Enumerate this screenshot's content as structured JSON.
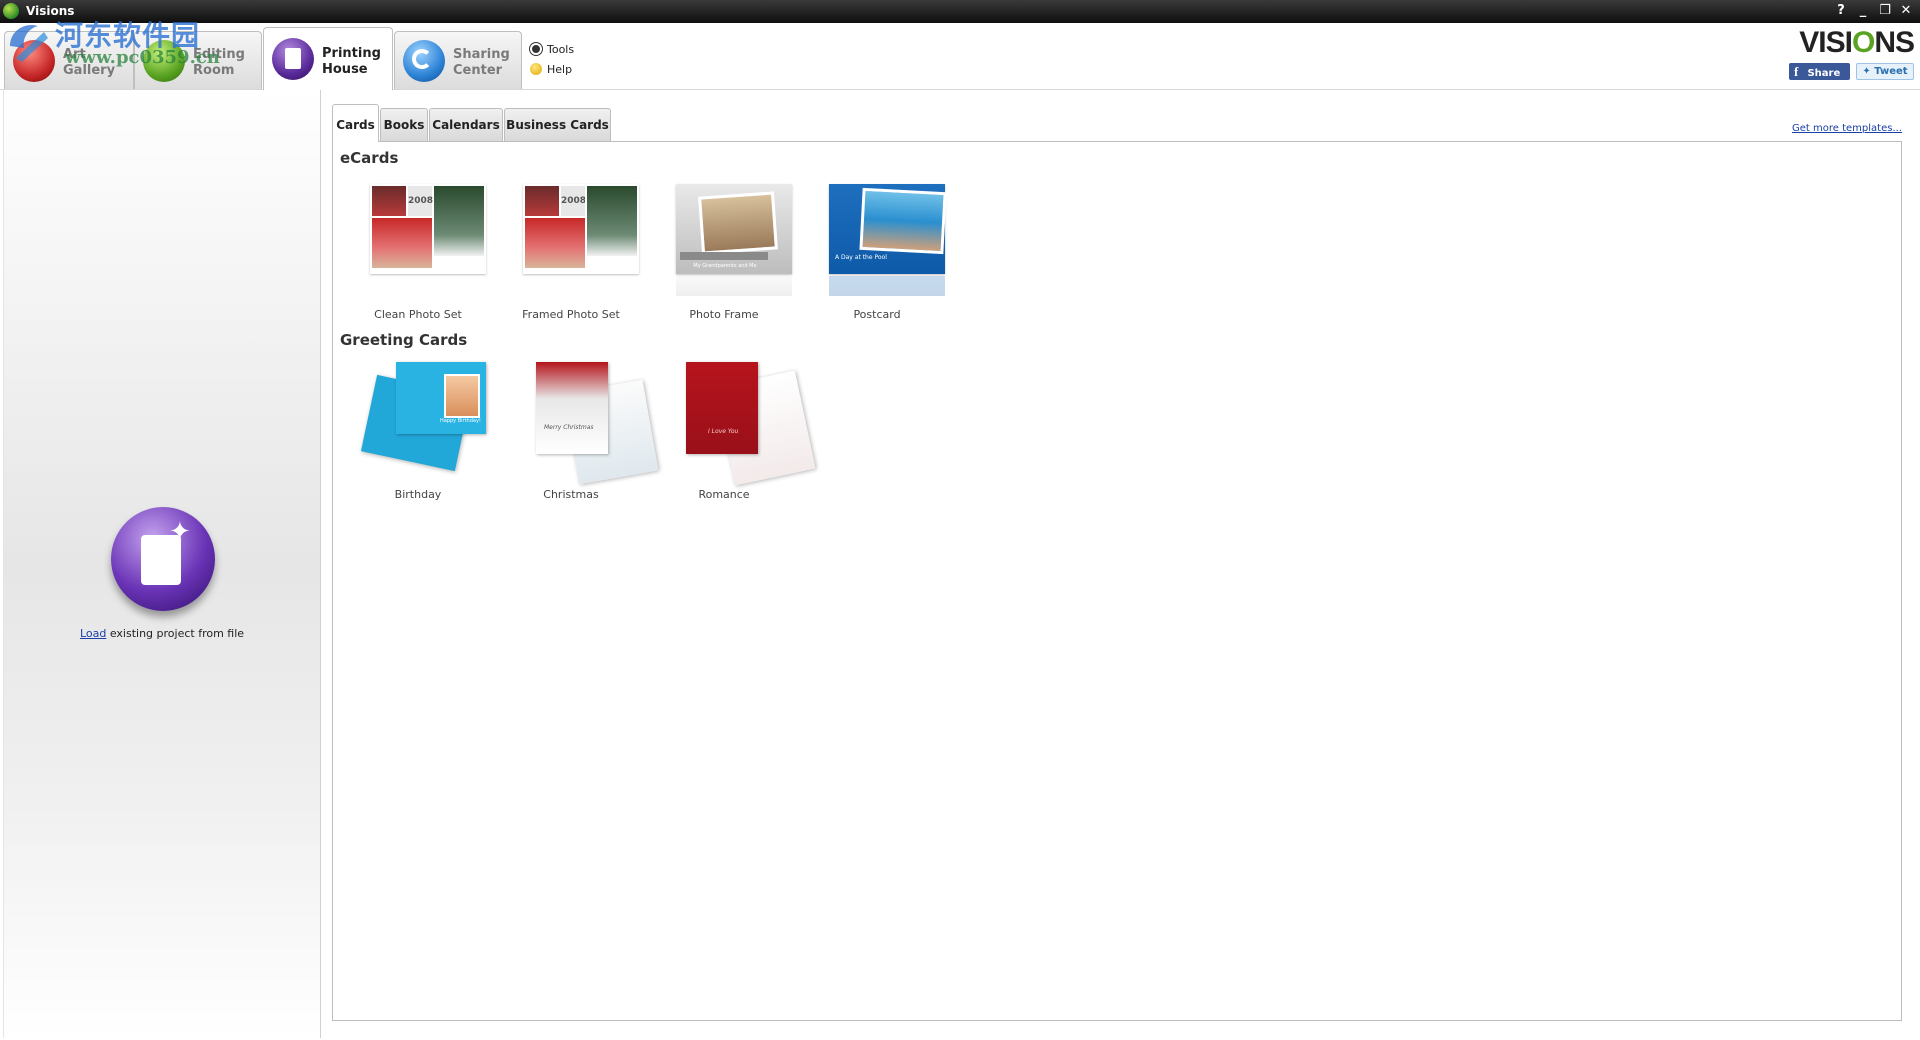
{
  "window": {
    "title": "Visions",
    "controls": [
      "?",
      "_",
      "❐",
      "✕"
    ]
  },
  "watermark": {
    "cn_text": "河东软件园",
    "url": "www.pc0359.cn"
  },
  "main_tabs": [
    {
      "label": "Art\nGallery",
      "icon": "art-gallery-icon",
      "active": false
    },
    {
      "label": "Editing\nRoom",
      "icon": "editing-room-icon",
      "active": false
    },
    {
      "label": "Printing\nHouse",
      "icon": "printing-house-icon",
      "active": true
    },
    {
      "label": "Sharing\nCenter",
      "icon": "sharing-center-icon",
      "active": false
    }
  ],
  "side_links": {
    "tools": "Tools",
    "help": "Help"
  },
  "brand": {
    "pre": "VISI",
    "o": "O",
    "post": "NS"
  },
  "social": {
    "share": "Share",
    "tweet": "Tweet"
  },
  "left_panel": {
    "load_link": "Load",
    "load_rest": " existing project from file"
  },
  "sub_tabs": [
    "Cards",
    "Books",
    "Calendars",
    "Business Cards"
  ],
  "more_templates": "Get more templates...",
  "sections": {
    "ecards": {
      "title": "eCards",
      "items": [
        "Clean Photo Set",
        "Framed Photo Set",
        "Photo Frame",
        "Postcard"
      ],
      "thumb_text": {
        "year": "2008",
        "frame_caption": "My Grandparents and Me",
        "postcard_caption": "A Day at the Pool"
      }
    },
    "greeting": {
      "title": "Greeting Cards",
      "items": [
        "Birthday",
        "Christmas",
        "Romance"
      ],
      "thumb_text": {
        "birthday": "Happy Birthday!",
        "christmas": "Merry Christmas",
        "romance": "I Love You"
      }
    }
  }
}
